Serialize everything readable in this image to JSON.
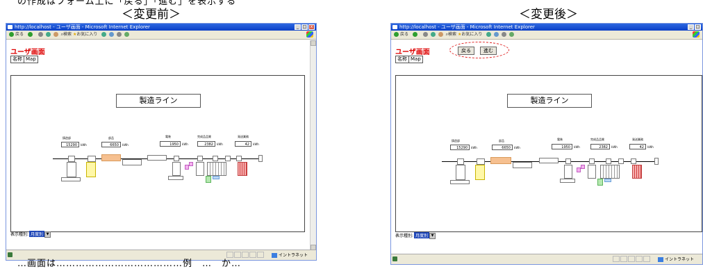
{
  "top_cut_text": "の作成はフォーム上に「戻る」「進む」を表示する",
  "headings": {
    "before": "＜変更前＞",
    "after": "＜変更後＞"
  },
  "bottom_cut_text": "…画面は…………………………………例　…　か…",
  "browser": {
    "title": "http://localhost - ユーザ画面 - Microsoft Internet Explorer",
    "toolbar_back": "戻る",
    "toolbar_search": "検索",
    "toolbar_favorites": "お気に入り",
    "zone": "イントラネット"
  },
  "app": {
    "title": "ユーザ画面",
    "tabs": [
      "名称",
      "Map"
    ],
    "nav_back": "戻る",
    "nav_forward": "進む",
    "line_title": "製造ライン",
    "select_label": "表示種別:",
    "select_value": "月度別"
  },
  "meters": [
    {
      "label": "鋳造部",
      "value": "15290",
      "unit": "kWh"
    },
    {
      "label": "部品",
      "value": "6650",
      "unit": "kWh"
    },
    {
      "label": "電装",
      "value": "1950",
      "unit": "kWh"
    },
    {
      "label": "完成品品質",
      "value": "2382",
      "unit": "kWh"
    },
    {
      "label": "発送業務",
      "value": "42",
      "unit": "kWh"
    }
  ],
  "colors": {
    "titlebar": "#0a3fc7",
    "app_title": "#dd0000",
    "highlight": "#e02020"
  }
}
